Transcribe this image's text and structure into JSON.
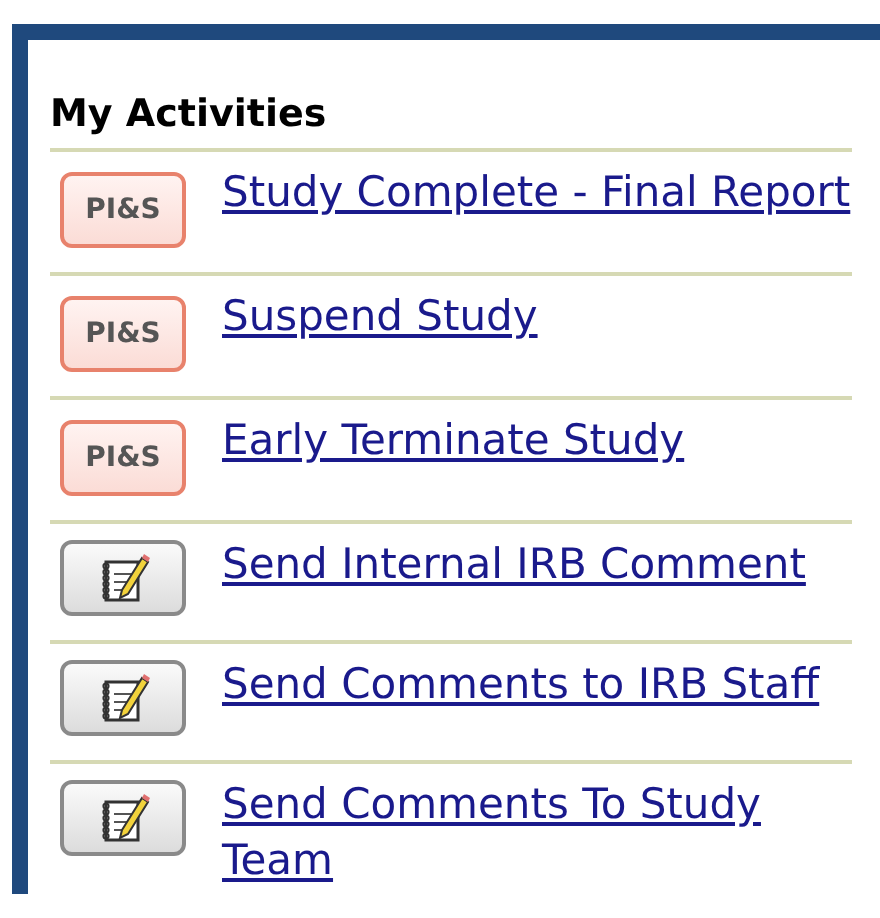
{
  "panel": {
    "title": "My Activities",
    "activities": [
      {
        "kind": "badge",
        "badge": "PI&S",
        "label": "Study Complete - Final Report"
      },
      {
        "kind": "badge",
        "badge": "PI&S",
        "label": "Suspend Study"
      },
      {
        "kind": "badge",
        "badge": "PI&S",
        "label": "Early Terminate Study"
      },
      {
        "kind": "notepad",
        "label": "Send Internal IRB Comment"
      },
      {
        "kind": "notepad",
        "label": "Send Comments to IRB Staff"
      },
      {
        "kind": "notepad",
        "label": "Send Comments To Study Team"
      }
    ]
  }
}
